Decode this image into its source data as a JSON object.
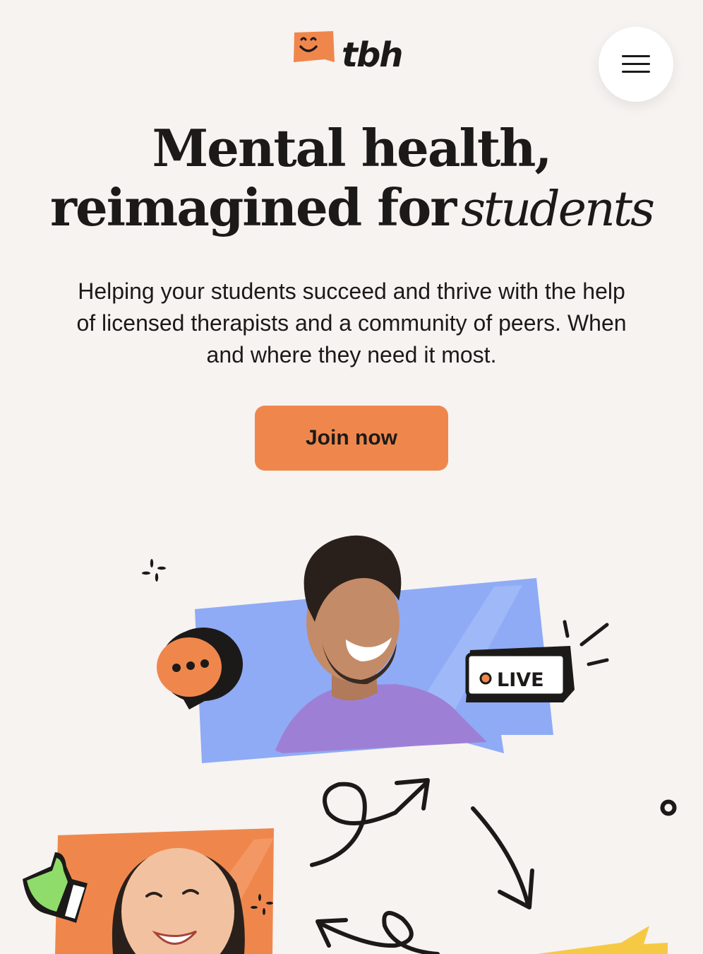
{
  "brand": {
    "name": "tbh",
    "accent": "#ef874c"
  },
  "header": {
    "menu_icon": "hamburger-menu-icon"
  },
  "hero": {
    "title_line1": "Mental health,",
    "title_line2": "reimagined for",
    "title_script": "students",
    "subtitle": "Helping your students succeed and thrive with the help of licensed therapists and a community of peers. When and where they need it most.",
    "cta_label": "Join now"
  },
  "illustration": {
    "live_label": "LIVE",
    "icons": [
      "chat-bubble-icon",
      "live-badge-icon",
      "thumbs-up-icon",
      "sparkle-icon",
      "loop-arrow-icon"
    ],
    "colors": {
      "blue": "#8fabf5",
      "orange": "#ef874c",
      "green": "#8fdc6a",
      "yellow": "#f6c945"
    }
  }
}
